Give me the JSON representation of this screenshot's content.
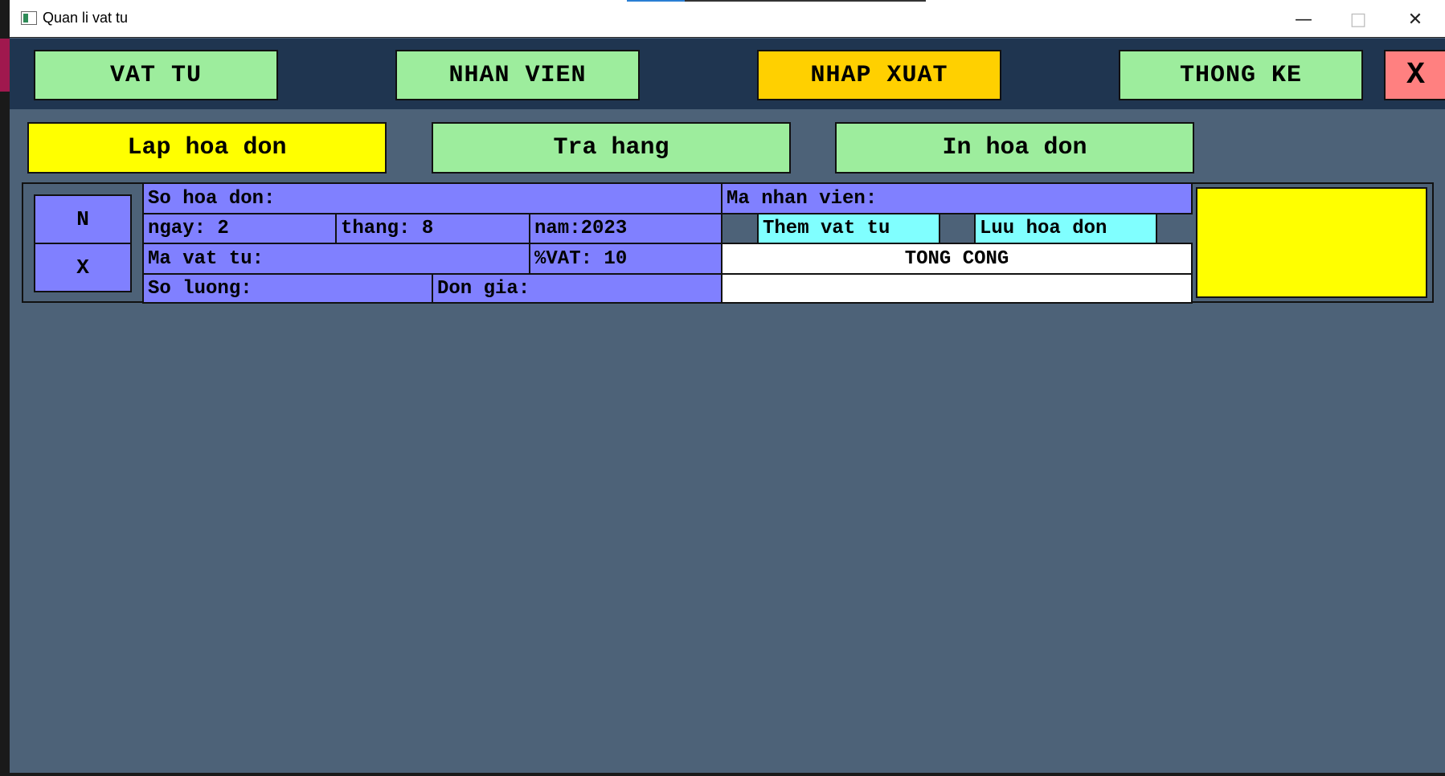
{
  "window": {
    "title": "Quan li vat tu",
    "controls": {
      "minimize": "—",
      "maximize": "□",
      "close": "✕"
    }
  },
  "nav": {
    "vat_tu": "VAT TU",
    "nhan_vien": "NHAN VIEN",
    "nhap_xuat": "NHAP XUAT",
    "thong_ke": "THONG KE",
    "exit": "X"
  },
  "subnav": {
    "lap_hoa_don": "Lap hoa don",
    "tra_hang": "Tra hang",
    "in_hoa_don": "In hoa don"
  },
  "form": {
    "type_n": "N",
    "type_x": "X",
    "so_hoa_don": "So hoa don:",
    "ma_nhan_vien": "Ma nhan vien:",
    "ngay": "ngay: 2",
    "thang": "thang: 8",
    "nam": "nam:2023",
    "ma_vat_tu": "Ma vat tu:",
    "vat": "%VAT: 10",
    "so_luong": "So luong:",
    "don_gia": "Don gia:",
    "them_vat_tu": "Them vat tu",
    "luu_hoa_don": "Luu hoa don",
    "tong_cong": "TONG CONG",
    "tong_cong_value": ""
  },
  "colors": {
    "nav_default": "#9ded9d",
    "nav_active": "#ffd000",
    "sub_active": "#ffff00",
    "exit": "#ff8080",
    "form_cell": "#8080ff",
    "action_button": "#80ffff",
    "background": "#4d6278",
    "navbar": "#1f3550"
  }
}
